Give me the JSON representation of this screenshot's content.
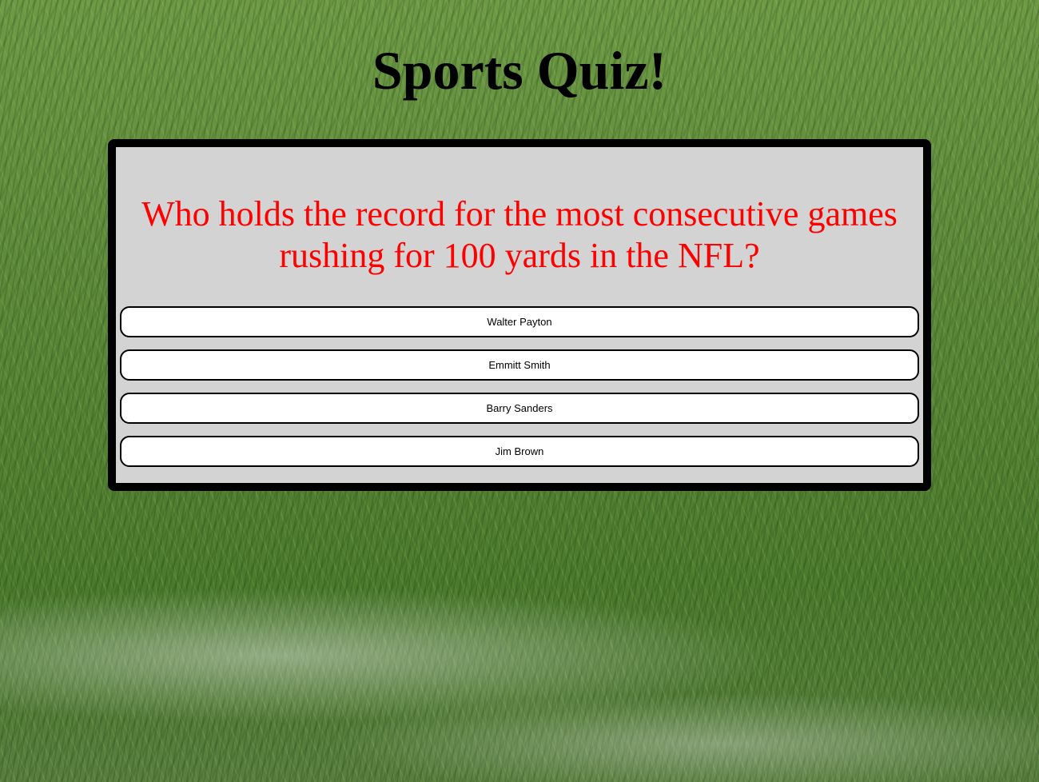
{
  "page": {
    "title": "Sports Quiz!"
  },
  "quiz": {
    "question": "Who holds the record for the most consecutive games rushing for 100 yards in the NFL?",
    "answers": [
      {
        "label": "Walter Payton"
      },
      {
        "label": "Emmitt Smith"
      },
      {
        "label": "Barry Sanders"
      },
      {
        "label": "Jim Brown"
      }
    ]
  },
  "colors": {
    "question_text": "#ff0000",
    "card_background": "#d3d3d3",
    "card_border": "#000000",
    "button_background": "#ffffff"
  }
}
